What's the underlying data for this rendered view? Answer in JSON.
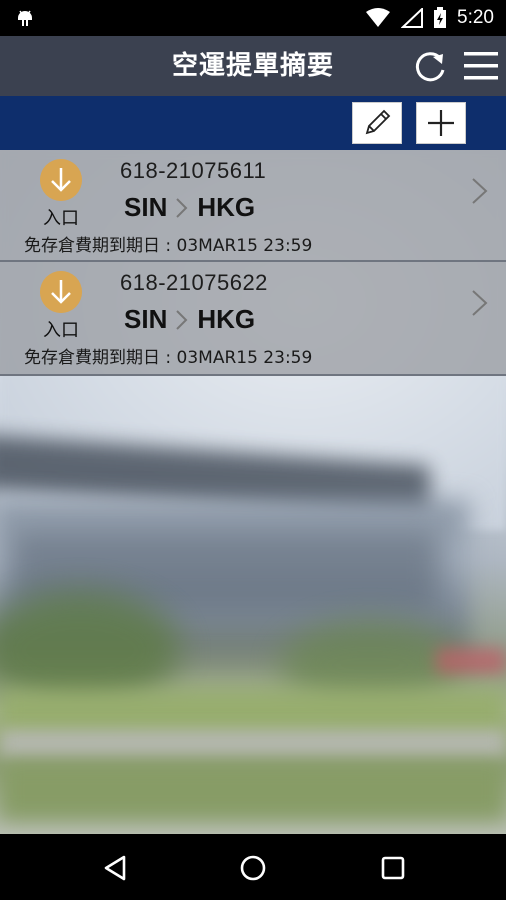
{
  "status_bar": {
    "time": "5:20"
  },
  "header": {
    "title": "空運提單摘要"
  },
  "shipments": [
    {
      "status": "入口",
      "awb": "618-21075611",
      "origin": "SIN",
      "destination": "HKG",
      "expiry": "免存倉費期到期日 : 03MAR15 23:59"
    },
    {
      "status": "入口",
      "awb": "618-21075622",
      "origin": "SIN",
      "destination": "HKG",
      "expiry": "免存倉費期到期日 : 03MAR15 23:59"
    }
  ],
  "colors": {
    "header_bg": "#3b4150",
    "toolbar_bg": "#0e2e6c",
    "status_icon": "#d8a552"
  },
  "icons": {
    "status": "arrow-down-circle-icon",
    "edit": "pencil-icon",
    "add": "plus-icon",
    "refresh": "refresh-icon",
    "menu": "hamburger-menu-icon"
  }
}
